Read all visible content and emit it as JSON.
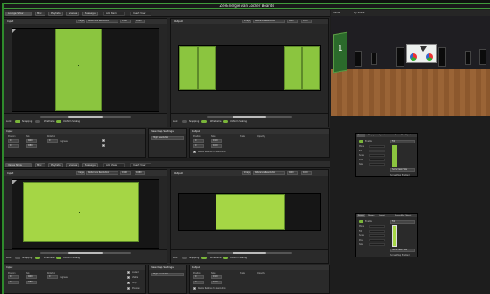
{
  "app": {
    "title": "ZeeEnergie van Locker Boards"
  },
  "scene": {
    "label_1": "Venue",
    "label_2": "My Scene",
    "sign_number": "1"
  },
  "top": {
    "tabs": [
      "Lounge Show",
      "Mix",
      "Playlists",
      "Scenes",
      "Messages"
    ],
    "add_label": "Add Item",
    "insert_label": "Insert View",
    "left_title": "Input",
    "right_title": "Output",
    "image_btn": "Image",
    "res_label": "Reference Resolution",
    "res_w": "1920",
    "res_h": "1080",
    "left_toggles": [
      "Lock",
      "Snapping",
      "Wireframe",
      "Uniform Scaling"
    ],
    "right_toggles": [
      "Lock",
      "Snapping",
      "Wireframe",
      "Uniform Scaling"
    ]
  },
  "bottom": {
    "tabs": [
      "Venue Show",
      "Mix",
      "Playlists",
      "Scenes",
      "Messages"
    ],
    "add_label": "Add View",
    "insert_label": "Insert View",
    "left_title": "Input",
    "right_title": "Output",
    "image_btn": "Image",
    "res_label": "Reference Resolution",
    "res_w": "1920",
    "res_h": "1080",
    "left_toggles": [
      "Lock",
      "Snapping",
      "Wireframe",
      "Uniform Scaling"
    ],
    "right_toggles": [
      "Lock",
      "Snapping",
      "Wireframe",
      "Uniform Scaling"
    ]
  },
  "info_top": {
    "input_title": "Input",
    "view_map_title": "View Map Settings",
    "view_map_value": "High Resolution",
    "output_title": "Output",
    "labels": [
      "Position",
      "Size",
      "Rotation",
      "Scale",
      "Opacity"
    ],
    "x": "0",
    "y": "0",
    "w": "1920",
    "h": "1080",
    "r": "0",
    "unit": "degrees",
    "resize_label": "Resize Relative to Resolution"
  },
  "info_bottom": {
    "input_title": "Input",
    "view_map_title": "View Map Settings",
    "view_map_value": "High Resolution",
    "output_title": "Output",
    "labels": [
      "Position",
      "Size",
      "Rotation",
      "Scale",
      "Opacity"
    ],
    "x": "0",
    "y": "0",
    "w": "1920",
    "h": "1080",
    "r": "0",
    "unit": "degrees",
    "check_labels": [
      "Locked",
      "Visible",
      "Snap",
      "Preview"
    ],
    "resize_label": "Resize Relative to Resolution"
  },
  "panels": {
    "tabs": [
      "Screen",
      "Display",
      "Layout"
    ],
    "mix_title": "ScreenMap Object",
    "enabled_label": "Enable",
    "rows": [
      "Mode",
      "Fill",
      "Scale",
      "Pos",
      "Size"
    ],
    "select_value": "Fill",
    "fit_label": "Set Screen Size",
    "status_label": "ScreenMap Enabled"
  },
  "colors": {
    "accent": "#8bc53f",
    "frame": "#2f8a2c",
    "panel": "#242424"
  }
}
